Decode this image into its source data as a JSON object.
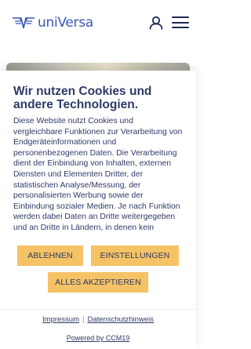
{
  "header": {
    "logo_text": "uniVersa",
    "icons": [
      "logo-wings-icon",
      "user-icon",
      "hamburger-menu-icon"
    ],
    "brand_color": "#3c58b4"
  },
  "cookie_banner": {
    "title": "Wir nutzen Cookies und andere Technologien.",
    "body": "Diese Website nutzt Cookies und vergleichbare Funktionen zur Verarbeitung von Endgeräteinformationen und personenbezogenen Daten. Die Verarbeitung dient der Einbindung von Inhalten, externen Diensten und Elementen Dritter, der statistischen Analyse/Messung, der personalisierten Werbung sowie der Einbindung sozialer Medien. Je nach Funktion werden dabei Daten an Dritte weitergegeben und an Dritte in Ländern, in denen kein",
    "buttons": {
      "decline": "ABLEHNEN",
      "settings": "EINSTELLUNGEN",
      "accept_all": "ALLES AKZEPTIEREN"
    },
    "button_color": "#f5c265",
    "links": {
      "imprint": "Impressum",
      "separator": "|",
      "privacy": "Datenschutzhinweis"
    },
    "powered_by": "Powered by CCM19"
  }
}
